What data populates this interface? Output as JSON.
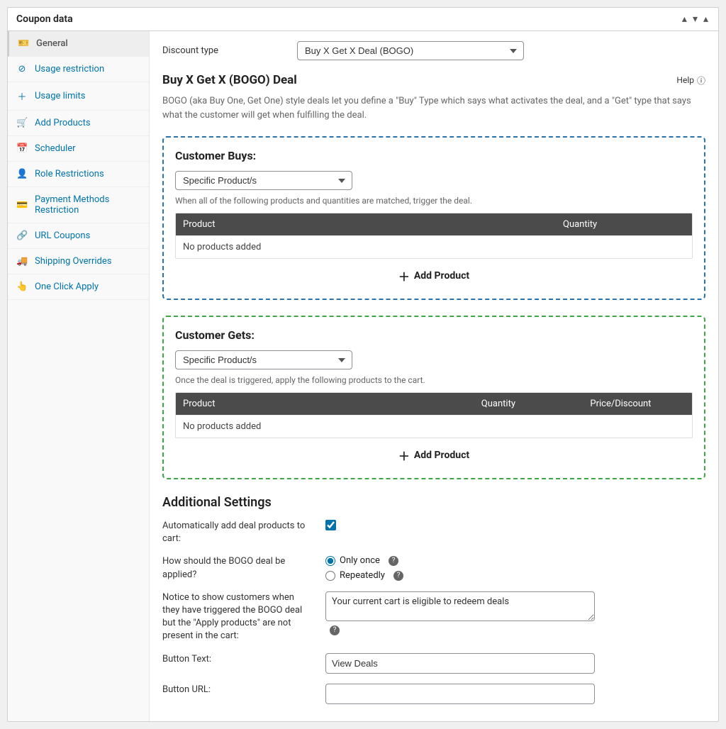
{
  "panel_title": "Coupon data",
  "sidebar": {
    "items": [
      {
        "label": "General",
        "icon": "🎫"
      },
      {
        "label": "Usage restriction",
        "icon": "⊘"
      },
      {
        "label": "Usage limits",
        "icon": "＋"
      },
      {
        "label": "Add Products",
        "icon": "🛒"
      },
      {
        "label": "Scheduler",
        "icon": "📅"
      },
      {
        "label": "Role Restrictions",
        "icon": "👤"
      },
      {
        "label": "Payment Methods Restriction",
        "icon": "💳"
      },
      {
        "label": "URL Coupons",
        "icon": "🔗"
      },
      {
        "label": "Shipping Overrides",
        "icon": "🚚"
      },
      {
        "label": "One Click Apply",
        "icon": "👆"
      }
    ]
  },
  "discount_type_label": "Discount type",
  "discount_type_value": "Buy X Get X Deal (BOGO)",
  "section": {
    "title": "Buy X Get X (BOGO) Deal",
    "help": "Help",
    "description": "BOGO (aka Buy One, Get One) style deals let you define a \"Buy\" Type which says what activates the deal, and a \"Get\" type that says what the customer will get when fulfilling the deal."
  },
  "buys": {
    "title": "Customer Buys:",
    "select": "Specific Product/s",
    "hint": "When all of the following products and quantities are matched, trigger the deal.",
    "head_product": "Product",
    "head_qty": "Quantity",
    "empty": "No products added",
    "add": "Add Product"
  },
  "gets": {
    "title": "Customer Gets:",
    "select": "Specific Product/s",
    "hint": "Once the deal is triggered, apply the following products to the cart.",
    "head_product": "Product",
    "head_qty": "Quantity",
    "head_price": "Price/Discount",
    "empty": "No products added",
    "add": "Add Product"
  },
  "additional": {
    "title": "Additional Settings",
    "auto_add_label": "Automatically add deal products to cart:",
    "auto_add_checked": true,
    "apply_label": "How should the BOGO deal be applied?",
    "apply_once": "Only once",
    "apply_repeat": "Repeatedly",
    "notice_label": "Notice to show customers when they have triggered the BOGO deal but the \"Apply products\" are not present in the cart:",
    "notice_value": "Your current cart is eligible to redeem deals",
    "button_text_label": "Button Text:",
    "button_text_value": "View Deals",
    "button_url_label": "Button URL:",
    "button_url_value": ""
  }
}
